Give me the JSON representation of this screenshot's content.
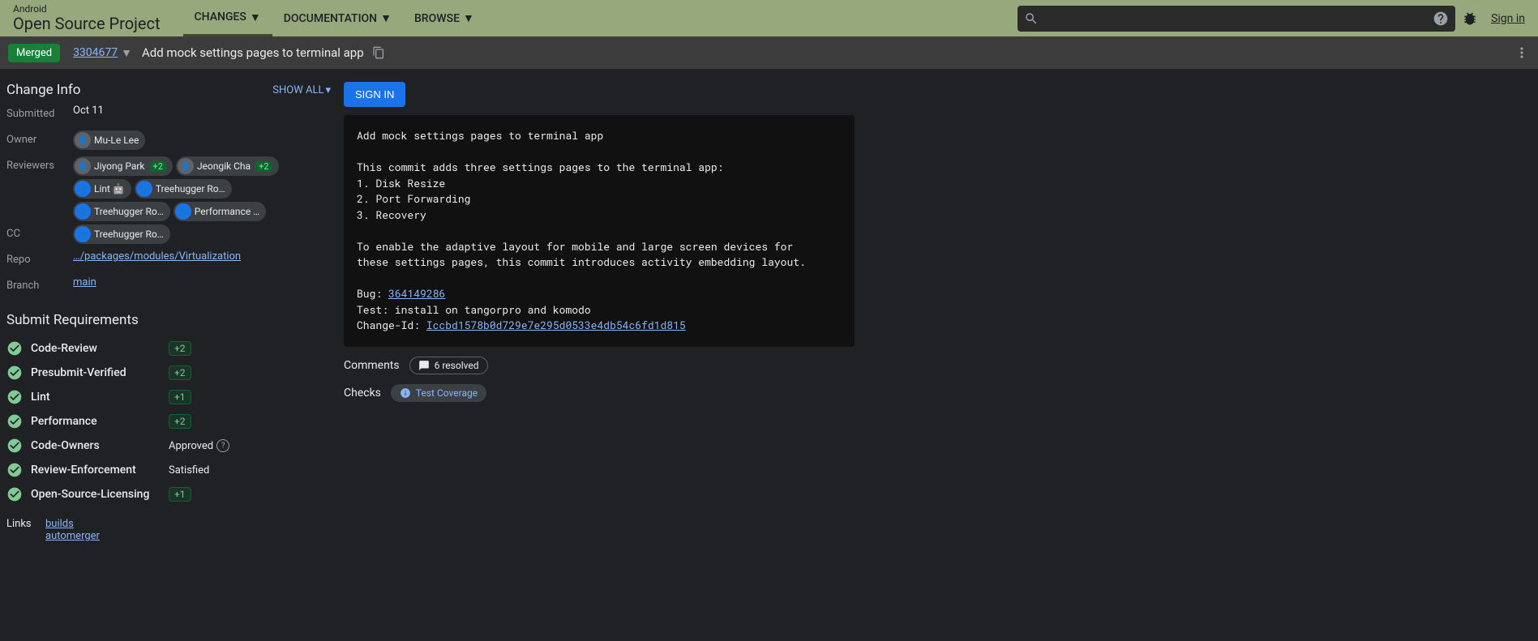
{
  "header": {
    "logo_small": "Android",
    "logo_big": "Open Source Project",
    "tabs": {
      "changes": "CHANGES",
      "documentation": "DOCUMENTATION",
      "browse": "BROWSE"
    },
    "signin": "Sign in"
  },
  "subheader": {
    "status": "Merged",
    "change_num": "3304677",
    "title": "Add mock settings pages to terminal app"
  },
  "info": {
    "section": "Change Info",
    "show_all": "SHOW ALL",
    "submitted_label": "Submitted",
    "submitted": "Oct 11",
    "owner_label": "Owner",
    "owner": "Mu-Le Lee",
    "reviewers_label": "Reviewers",
    "r1": "Jiyong Park",
    "r1v": "+2",
    "r2": "Jeongik Cha",
    "r2v": "+2",
    "r3": "Lint 🤖",
    "r4": "Treehugger Ro…",
    "r5": "Treehugger Ro…",
    "r6": "Performance …",
    "cc_label": "CC",
    "cc1": "Treehugger Ro…",
    "repo_label": "Repo",
    "repo": "…/packages/modules/Virtualization",
    "branch_label": "Branch",
    "branch": "main"
  },
  "submit": {
    "title": "Submit Requirements",
    "r1": "Code-Review",
    "r1v": "+2",
    "r2": "Presubmit-Verified",
    "r2v": "+2",
    "r3": "Lint",
    "r3v": "+1",
    "r4": "Performance",
    "r4v": "+2",
    "r5": "Code-Owners",
    "r5v": "Approved",
    "r6": "Review-Enforcement",
    "r6v": "Satisfied",
    "r7": "Open-Source-Licensing",
    "r7v": "+1"
  },
  "links": {
    "label": "Links",
    "l1": "builds",
    "l2": "automerger"
  },
  "right": {
    "signin_btn": "SIGN IN",
    "bug_label": "Bug: ",
    "bug": "364149286",
    "changeid_label": "Change-Id: ",
    "changeid": "Iccbd1578b0d729e7e295d0533e4db54c6fd1d815",
    "msg_l1": "Add mock settings pages to terminal app",
    "msg_l2": "This commit adds three settings pages to the terminal app:",
    "msg_l3": "1. Disk Resize",
    "msg_l4": "2. Port Forwarding",
    "msg_l5": "3. Recovery",
    "msg_l6": "To enable the adaptive layout for mobile and large screen devices for",
    "msg_l7": "these settings pages, this commit introduces activity embedding layout.",
    "msg_l8": "Test: install on tangorpro and komodo",
    "comments_label": "Comments",
    "comments_pill": "6 resolved",
    "checks_label": "Checks",
    "checks_pill": "Test Coverage"
  }
}
